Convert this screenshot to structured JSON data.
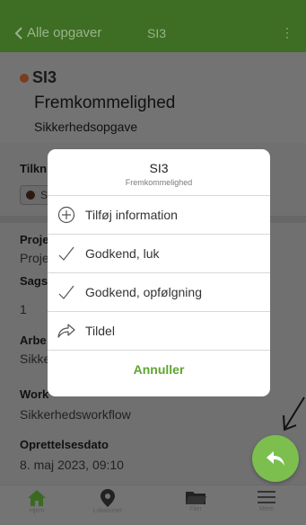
{
  "navbar": {
    "back_label": "Alle opgaver",
    "title": "SI3",
    "more_glyph": "⋮"
  },
  "task": {
    "code": "SI3",
    "name": "Fremkommelighed",
    "type": "Sikkerhedsopgave",
    "status_color": "#c26a2e"
  },
  "sections": {
    "tilk_label": "Tilkn",
    "chip_text": "S",
    "proj_label": "Proje",
    "proj_value": "Proje",
    "sags_label": "Sags",
    "sags_value": "1",
    "arbe_label": "Arbe",
    "arbe_value": "Sikke",
    "workflow_label": "Work",
    "workflow_value": "Sikkerhedsworkflow",
    "created_label": "Oprettelsesdato",
    "created_value": "8. maj 2023, 09:10"
  },
  "modal": {
    "title": "SI3",
    "subtitle": "Fremkommelighed",
    "actions": [
      {
        "label": "Tilføj information",
        "icon": "plus-circle-icon"
      },
      {
        "label": "Godkend, luk",
        "icon": "check-icon"
      },
      {
        "label": "Godkend, opfølgning",
        "icon": "check-icon"
      },
      {
        "label": "Tildel",
        "icon": "share-arrow-icon"
      }
    ],
    "cancel_label": "Annuller"
  },
  "tabbar": {
    "items": [
      {
        "label": "Hjem",
        "icon": "home-icon"
      },
      {
        "label": "Lokationer",
        "icon": "location-pin-icon"
      },
      {
        "label": "Filer",
        "icon": "folder-icon"
      },
      {
        "label": "Mere",
        "icon": "menu-icon"
      }
    ]
  },
  "colors": {
    "accent": "#7cbf4f",
    "navbar": "#3d6e23",
    "cancel_text": "#5fa52f"
  }
}
